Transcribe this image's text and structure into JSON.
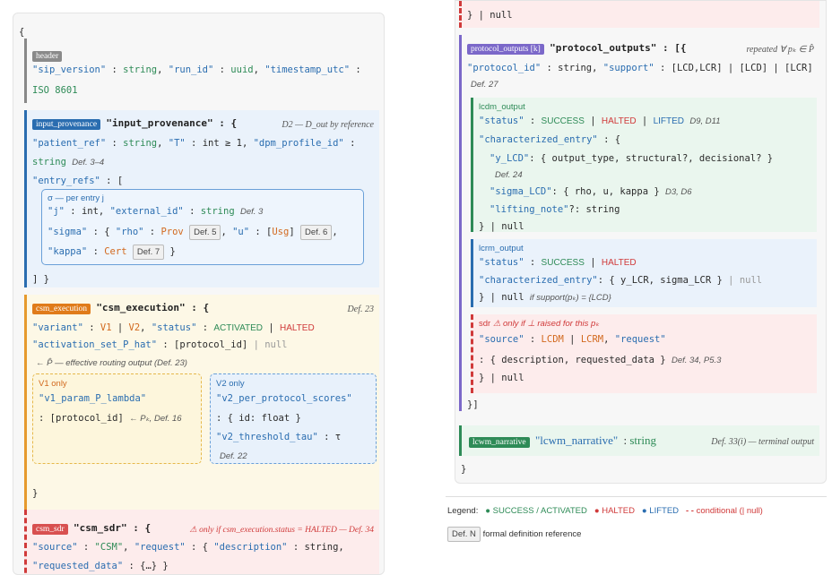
{
  "brace_open": "{",
  "brace_close": "}",
  "header": {
    "tag": "header",
    "sip_version_key": "\"sip_version\"",
    "string": "string",
    "run_id_key": "\"run_id\"",
    "uuid": "uuid",
    "timestamp_key": "\"timestamp_utc\"",
    "iso": "ISO 8601"
  },
  "input_provenance": {
    "tag": "input_provenance",
    "title": "\"input_provenance\" : {",
    "note": "D2 — D_out by reference",
    "patient_ref_key": "\"patient_ref\"",
    "string": "string",
    "T_key": "\"T\"",
    "int_ge": "int ≥ 1,",
    "dpm_key": "\"dpm_profile_id\"",
    "def34": "Def. 3–4",
    "entry_refs_key": "\"entry_refs\"",
    "per_entry_label": "σ — per entry j",
    "j_key": "\"j\"",
    "int": "int",
    "external_id_key": "\"external_id\"",
    "def3": "Def. 3",
    "sigma_key": "\"sigma\"",
    "rho_key": "\"rho\"",
    "prov": "Prov",
    "def5": "Def. 5",
    "u_key": "\"u\"",
    "usg": "Usg",
    "def6": "Def. 6",
    "kappa_key": "\"kappa\"",
    "cert": "Cert",
    "def7": "Def. 7",
    "close": "] }"
  },
  "csm_execution": {
    "tag": "csm_execution",
    "title": "\"csm_execution\" : {",
    "note": "Def. 23",
    "variant_key": "\"variant\"",
    "v1": "V1",
    "v2": "V2",
    "status_key": "\"status\"",
    "activated": "ACTIVATED",
    "halted": "HALTED",
    "activation_key": "\"activation_set_P_hat\"",
    "protocol_id_arr": "[protocol_id]",
    "null": "null",
    "routing_note": "← P̂ — effective routing output (Def. 23)",
    "v1_only": "V1 only",
    "v1_param_key": "\"v1_param_P_lambda\"",
    "v1_param_val": ": [protocol_id]",
    "v1_param_note": "← Pₖ, Def. 16",
    "v2_only": "V2 only",
    "v2_scores_key": "\"v2_per_protocol_scores\"",
    "v2_scores_val": ": { id: float }",
    "v2_tau_key": "\"v2_threshold_tau\"",
    "tau": "τ",
    "def22": "Def. 22",
    "close": "}"
  },
  "csm_sdr": {
    "tag": "csm_sdr",
    "title": "\"csm_sdr\" : {",
    "note": "⚠ only if csm_execution.status = HALTED — Def. 34",
    "source_key": "\"source\"",
    "csm": "\"CSM\"",
    "request_key": "\"request\"",
    "description_key": "\"description\"",
    "string": "string,",
    "requested_data_key": "\"requested_data\"",
    "rd_val": "{…} }"
  },
  "right": {
    "top_close": "} | null",
    "protocol_outputs": {
      "tag": "protocol_outputs [k]",
      "title": "\"protocol_outputs\" : [{",
      "note": "repeated ∀ pₖ ∈ P̂",
      "protocol_id_key": "\"protocol_id\"",
      "string": "string,",
      "support_key": "\"support\"",
      "support_val": "[LCD,LCR] | [LCD] | [LCR]",
      "def27": "Def. 27",
      "close": "}]"
    },
    "lcdm": {
      "label": "lcdm_output",
      "status_key": "\"status\"",
      "success": "SUCCESS",
      "halted": "HALTED",
      "lifted": "LIFTED",
      "defs": "D9, D11",
      "ce_key": "\"characterized_entry\"",
      "y_lcd_key": "\"y_LCD\"",
      "y_lcd_val": ": { output_type, structural?, decisional? }",
      "def24": "Def. 24",
      "sigma_lcd_key": "\"sigma_LCD\"",
      "sigma_lcd_val": ": { rho, u, kappa }",
      "sigma_defs": "D3, D6",
      "lifting_key": "\"lifting_note\"",
      "lifting_val": "?: string",
      "close": "} | null"
    },
    "lcrm": {
      "label": "lcrm_output",
      "status_key": "\"status\"",
      "success": "SUCCESS",
      "halted": "HALTED",
      "ce_key": "\"characterized_entry\"",
      "ce_val": ": { y_LCR, sigma_LCR }",
      "null": "| null",
      "close": "} | null",
      "close_note": "if support(pₖ) = {LCD}"
    },
    "sdr": {
      "label": "sdr",
      "note": "⚠ only if ⊥ raised for this pₖ",
      "source_key": "\"source\"",
      "lcdm": "LCDM",
      "lcrm": "LCRM",
      "request_key": "\"request\"",
      "desc_val": ": { description, requested_data }",
      "defs": "Def. 34, P5.3",
      "close": "} | null"
    },
    "lcwm": {
      "tag": "lcwm_narrative",
      "title": "\"lcwm_narrative\"",
      "string": "string",
      "note": "Def. 33(i) — terminal output"
    },
    "close": "}"
  },
  "legend": {
    "label": "Legend:",
    "success": "SUCCESS / ACTIVATED",
    "halted": "HALTED",
    "lifted": "LIFTED",
    "conditional": "conditional (| null)",
    "def_box": "Def. N",
    "def_text": "formal definition reference"
  },
  "colors": {
    "green": "#2e8b57",
    "red": "#d03a3a",
    "blue": "#2a6db0",
    "orange": "#d2691e",
    "purple": "#7b68c9"
  }
}
